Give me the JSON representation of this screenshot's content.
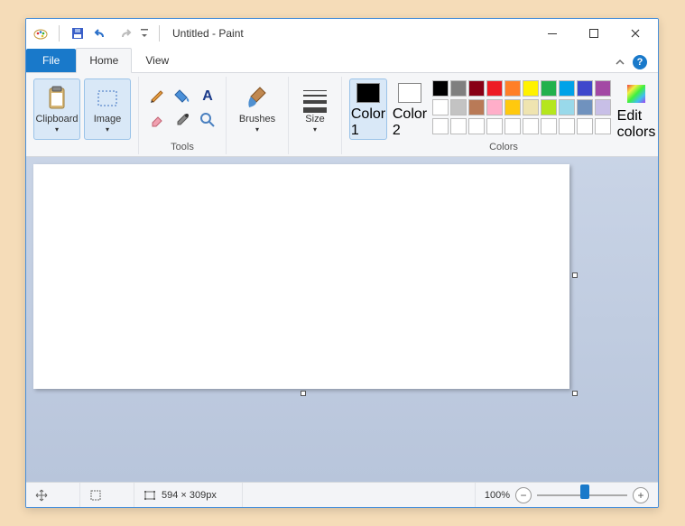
{
  "title": "Untitled - Paint",
  "tabs": {
    "file": "File",
    "home": "Home",
    "view": "View"
  },
  "ribbon": {
    "clipboard": {
      "label": "Clipboard"
    },
    "image": {
      "label": "Image"
    },
    "tools_group": "Tools",
    "brushes": {
      "label": "Brushes"
    },
    "size": {
      "label": "Size"
    },
    "color1": {
      "label": "Color\n1",
      "value": "#000000"
    },
    "color2": {
      "label": "Color\n2",
      "value": "#ffffff"
    },
    "colors_group": "Colors",
    "edit_colors": {
      "label": "Edit\ncolors"
    },
    "palette_row1": [
      "#000000",
      "#7f7f7f",
      "#880015",
      "#ed1c24",
      "#ff7f27",
      "#fff200",
      "#22b14c",
      "#00a2e8",
      "#3f48cc",
      "#a349a4"
    ],
    "palette_row2": [
      "#ffffff",
      "#c3c3c3",
      "#b97a57",
      "#ffaec9",
      "#ffc90e",
      "#efe4b0",
      "#b5e61d",
      "#99d9ea",
      "#7092be",
      "#c8bfe7"
    ]
  },
  "status": {
    "canvas_size": "594 × 309px",
    "zoom": "100%"
  }
}
